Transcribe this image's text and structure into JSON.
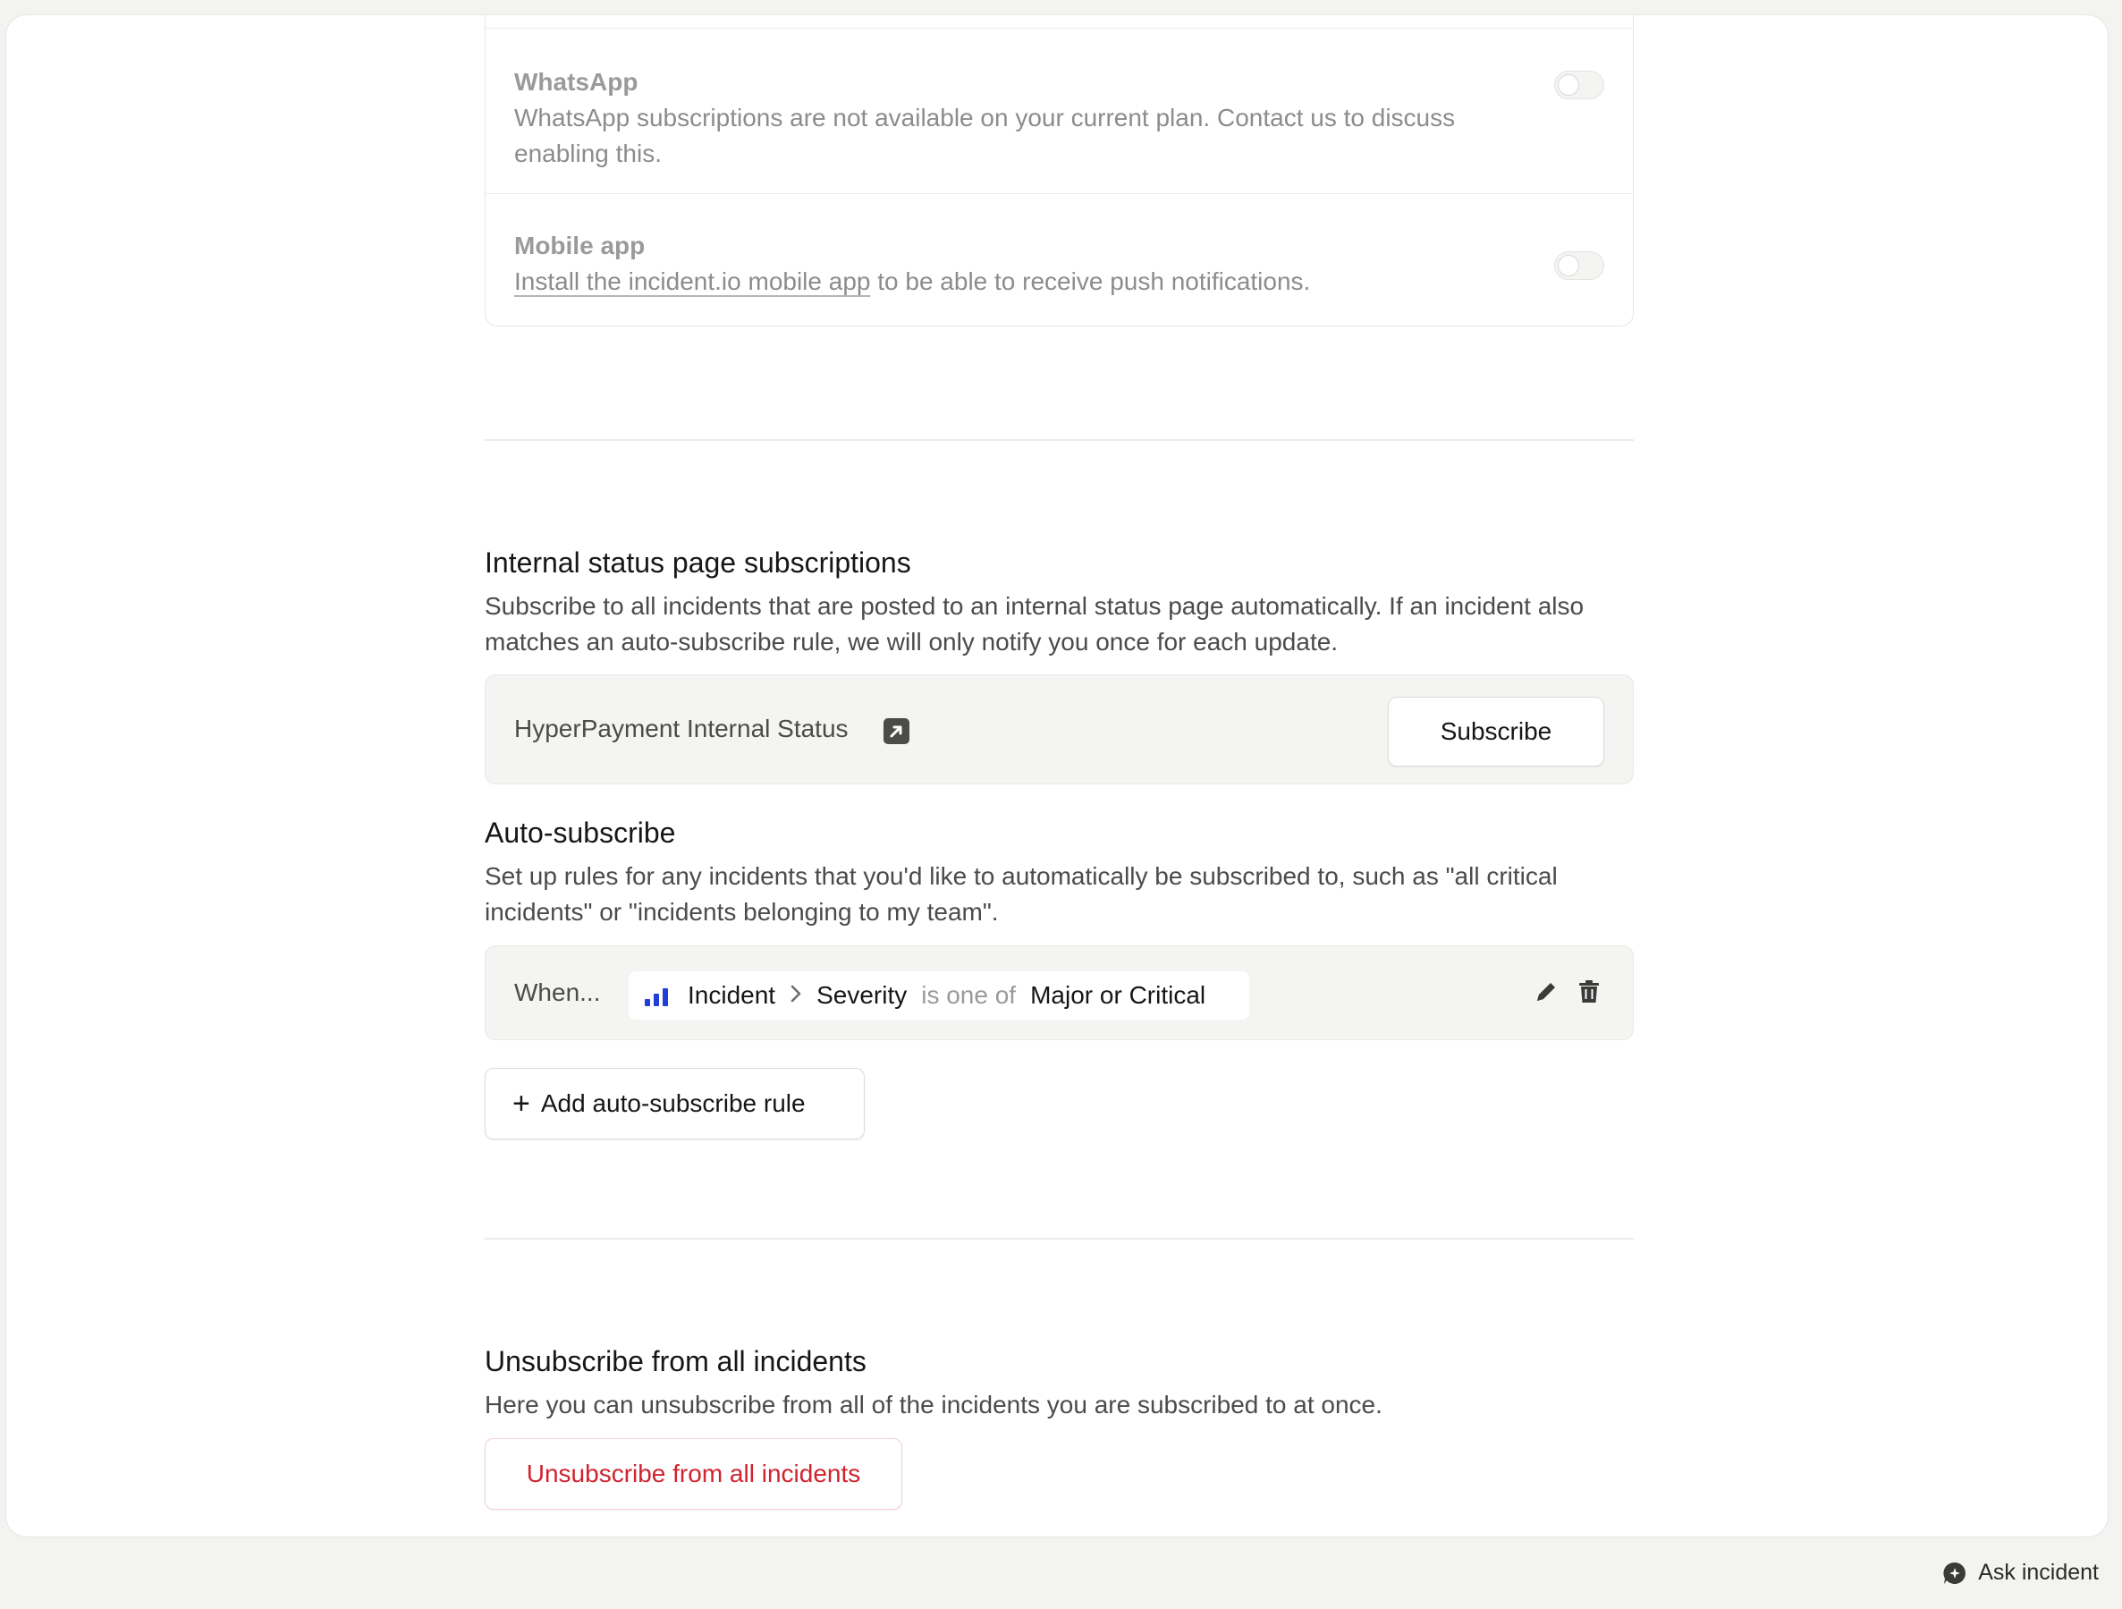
{
  "channels": {
    "whatsapp": {
      "title": "WhatsApp",
      "description": "WhatsApp subscriptions are not available on your current plan. Contact us to discuss enabling this."
    },
    "mobile": {
      "title": "Mobile app",
      "link_text": "Install the incident.io mobile app",
      "description_rest": " to be able to receive push notifications."
    }
  },
  "internal_status": {
    "title": "Internal status page subscriptions",
    "description": "Subscribe to all incidents that are posted to an internal status page automatically. If an incident also matches an auto-subscribe rule, we will only notify you once for each update.",
    "page_name": "HyperPayment Internal Status",
    "subscribe_label": "Subscribe"
  },
  "auto_subscribe": {
    "title": "Auto-subscribe",
    "description": "Set up rules for any incidents that you'd like to automatically be subscribed to, such as \"all critical incidents\" or \"incidents belonging to my team\".",
    "rule": {
      "when": "When...",
      "entity": "Incident",
      "field": "Severity",
      "operator": "is one of",
      "value": "Major or Critical"
    },
    "add_label": "Add auto-subscribe rule"
  },
  "unsubscribe": {
    "title": "Unsubscribe from all incidents",
    "description": "Here you can unsubscribe from all of the incidents you are subscribed to at once.",
    "button_label": "Unsubscribe from all incidents"
  },
  "footer": {
    "ask_label": "Ask incident"
  },
  "colors": {
    "danger": "#d0232f",
    "severity_icon": "#1f3fd6"
  }
}
